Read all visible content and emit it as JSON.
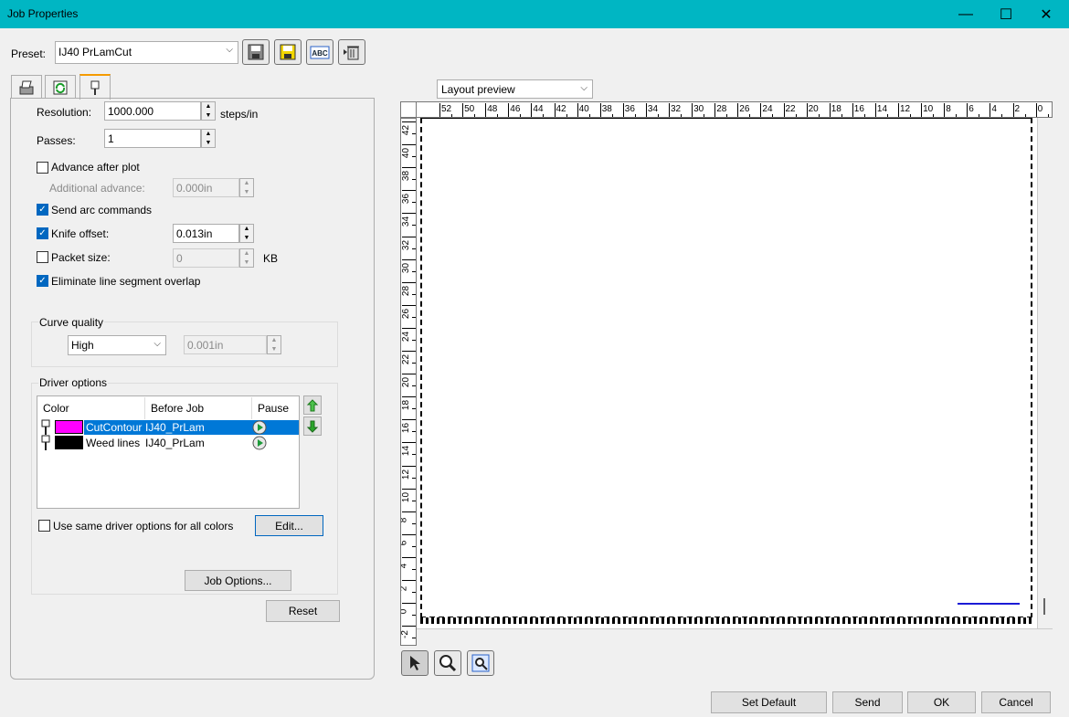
{
  "window": {
    "title": "Job Properties",
    "minimize": "—",
    "maximize": "☐",
    "close": "✕"
  },
  "preset": {
    "label": "Preset:",
    "value": "IJ40 PrLamCut"
  },
  "settings": {
    "resolution_label": "Resolution:",
    "resolution_value": "1000.000",
    "resolution_unit": "steps/in",
    "passes_label": "Passes:",
    "passes_value": "1",
    "advance_label": "Advance after plot",
    "advance_checked": false,
    "additional_advance_label": "Additional advance:",
    "additional_advance_value": "0.000in",
    "arc_label": "Send arc commands",
    "arc_checked": true,
    "knife_label": "Knife offset:",
    "knife_checked": true,
    "knife_value": "0.013in",
    "packet_label": "Packet size:",
    "packet_checked": false,
    "packet_value": "0",
    "packet_unit": "KB",
    "eliminate_label": "Eliminate line segment overlap",
    "eliminate_checked": true
  },
  "curve": {
    "group_label": "Curve quality",
    "quality": "High",
    "tolerance": "0.001in"
  },
  "driver": {
    "group_label": "Driver options",
    "headers": [
      "Color",
      "Before Job",
      "Pause"
    ],
    "rows": [
      {
        "name": "CutContour",
        "color": "#ff00ff",
        "before_job": "IJ40_PrLam",
        "selected": true
      },
      {
        "name": "Weed lines",
        "color": "#000000",
        "before_job": "IJ40_PrLam",
        "selected": false
      }
    ],
    "same_options_label": "Use same driver options for all colors",
    "edit_button": "Edit...",
    "job_options_button": "Job Options..."
  },
  "reset_button": "Reset",
  "preview": {
    "mode": "Layout preview",
    "h_ticks": [
      "52",
      "50",
      "48",
      "46",
      "44",
      "42",
      "40",
      "38",
      "36",
      "34",
      "32",
      "30",
      "28",
      "26",
      "24",
      "22",
      "20",
      "18",
      "16",
      "14",
      "12",
      "10",
      "8",
      "6",
      "4",
      "2",
      "0"
    ],
    "v_ticks": [
      "42",
      "40",
      "38",
      "36",
      "34",
      "32",
      "30",
      "28",
      "26",
      "24",
      "22",
      "20",
      "18",
      "16",
      "14",
      "12",
      "10",
      "8",
      "6",
      "4",
      "2",
      "0",
      "-2"
    ]
  },
  "footer": {
    "set_default": "Set Default",
    "send": "Send",
    "ok": "OK",
    "cancel": "Cancel"
  },
  "colors": {
    "titlebar": "#00b6c3",
    "selection": "#0078d7",
    "accent": "#0067c0"
  }
}
